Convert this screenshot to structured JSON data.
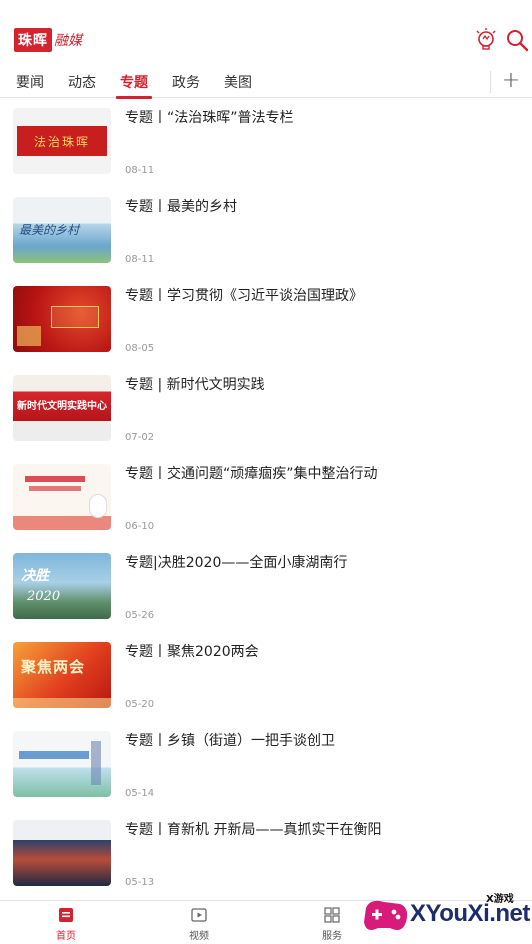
{
  "header": {
    "logo_main": "珠晖",
    "logo_sub": "融媒"
  },
  "tabs": [
    {
      "label": "要闻"
    },
    {
      "label": "动态"
    },
    {
      "label": "专题"
    },
    {
      "label": "政务"
    },
    {
      "label": "美图"
    }
  ],
  "tab_add_label": "+",
  "thumb_text": {
    "t0": "法治珠晖",
    "t1": "最美的乡村",
    "t3": "新时代文明实践中心",
    "t5": "决胜",
    "t6": "聚焦两会"
  },
  "articles": [
    {
      "title": "专题丨“法治珠晖”普法专栏",
      "date": "08-11"
    },
    {
      "title": "专题丨最美的乡村",
      "date": "08-11"
    },
    {
      "title": "专题丨学习贯彻《习近平谈治国理政》",
      "date": "08-05"
    },
    {
      "title": "专题 | 新时代文明实践",
      "date": "07-02"
    },
    {
      "title": "专题丨交通问题“顽瘴痼疾”集中整治行动",
      "date": "06-10"
    },
    {
      "title": "专题|决胜2020——全面小康湖南行",
      "date": "05-26"
    },
    {
      "title": "专题丨聚焦2020两会",
      "date": "05-20"
    },
    {
      "title": "专题丨乡镇（街道）一把手谈创卫",
      "date": "05-14"
    },
    {
      "title": "专题丨育新机  开新局——真抓实干在衡阳",
      "date": "05-13"
    }
  ],
  "bottom_nav": [
    {
      "label": "首页"
    },
    {
      "label": "视频"
    },
    {
      "label": "服务"
    }
  ],
  "watermark": {
    "small": "X游戏",
    "big": "XYouXi.net"
  },
  "colors": {
    "accent": "#d4232f"
  }
}
